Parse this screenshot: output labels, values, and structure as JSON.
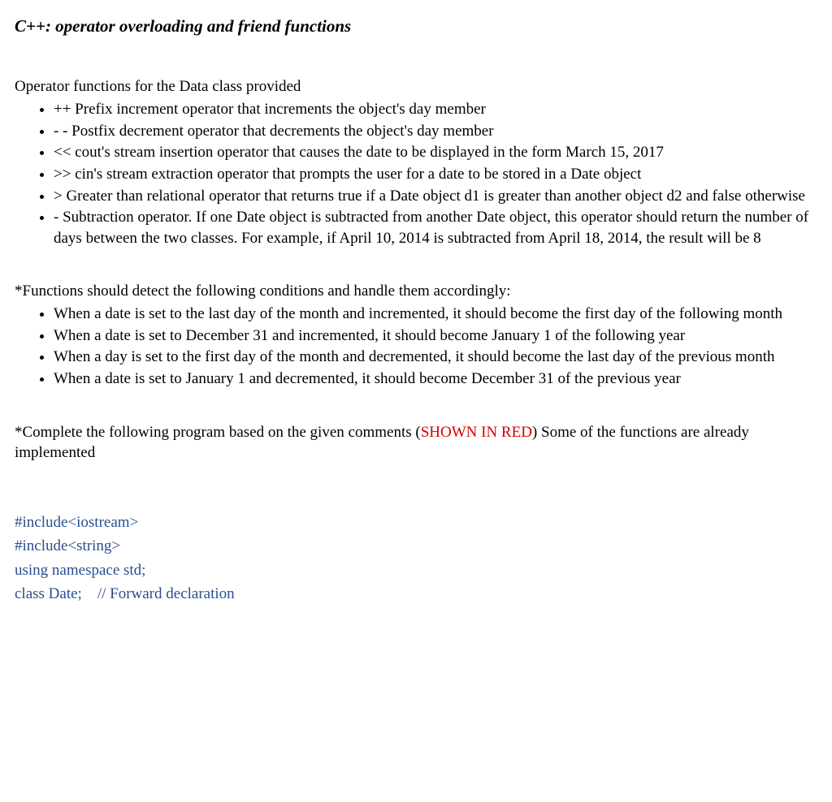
{
  "title": "C++: operator overloading and friend functions",
  "section1": {
    "lead": "Operator functions for the Data class provided",
    "items": [
      "++ Prefix increment operator that increments the object's day member",
      "- - Postfix decrement operator that decrements the object's day member",
      "<< cout's stream insertion operator that causes the date to be displayed in the form March 15, 2017",
      ">> cin's stream extraction operator that prompts the user for a date to be stored in a Date object",
      "> Greater than relational operator that returns true if a Date object d1 is greater than another object d2 and false otherwise",
      "- Subtraction operator.  If one Date object is subtracted from another Date object, this operator should return the number of days between the two classes.  For example, if April 10, 2014 is subtracted from April 18, 2014, the result will be 8"
    ]
  },
  "section2": {
    "lead": "*Functions should detect the following conditions and handle them accordingly:",
    "items": [
      "When a date is set to the last day of the month and incremented, it should become the first day of the following month",
      "When a date is set to December 31 and incremented, it should become January 1 of the following year",
      "When a day is set to the first day of the month and decremented, it should become the last day of the previous month",
      "When a date is set to January 1 and decremented, it should become December 31 of the previous year"
    ]
  },
  "section3": {
    "prefix": "*Complete the following program based on the given comments (",
    "red": "SHOWN IN RED",
    "suffix": ") Some of the functions are already implemented"
  },
  "code": {
    "l1": "#include<iostream>",
    "l2": "#include<string>",
    "l3": "using namespace std;",
    "l4": "",
    "l5": "class Date;    // Forward declaration"
  }
}
